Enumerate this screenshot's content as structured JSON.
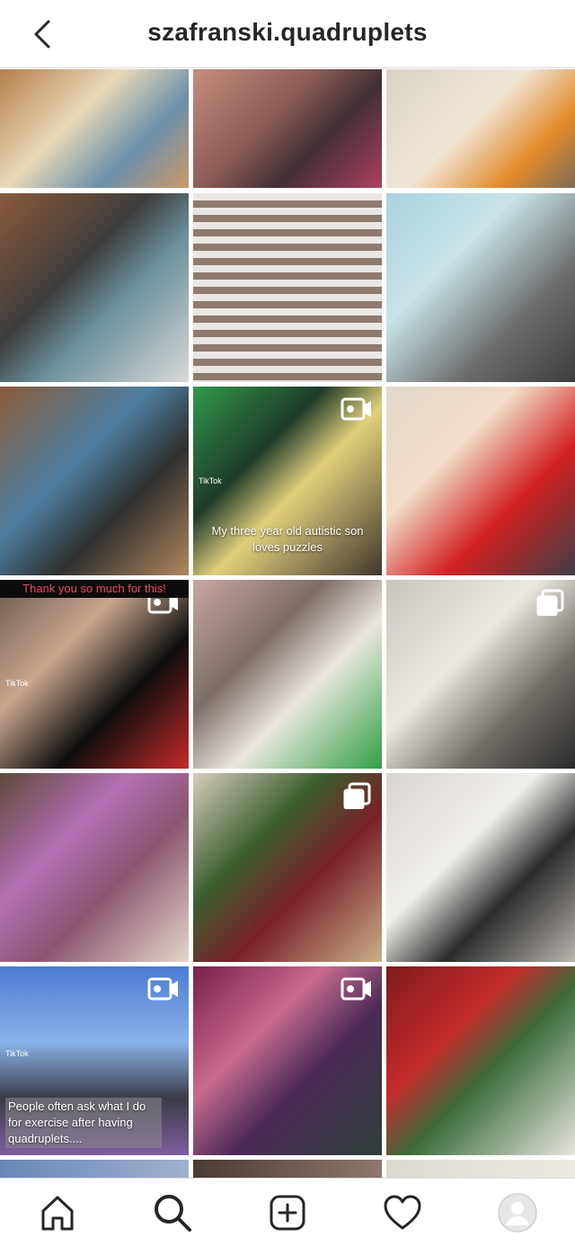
{
  "header": {
    "title": "szafranski.quadruplets"
  },
  "tiles": [
    {
      "bg": "linear-gradient(135deg,#b67f48 0%,#e8d9b8 40%,#6d8fa9 70%,#c99a6c 100%)"
    },
    {
      "bg": "linear-gradient(135deg,#c68c7d 0%,#8e5d57 40%,#3f2f35 65%,#b13f61 100%)"
    },
    {
      "bg": "linear-gradient(135deg,#d9d2c4 0%,#f0e6d8 45%,#e38a2a 75%,#7d6e5a 100%)"
    },
    {
      "bg": "linear-gradient(135deg,#8b5a3c 0%,#3d3d3d 40%,#6b8f9a 60%,#d9d9d9 100%)"
    },
    {
      "bg": "repeating-linear-gradient(180deg,#e9e6e3 0px,#e9e6e3 8px,#8f7a6e 8px,#8f7a6e 16px)"
    },
    {
      "bg": "linear-gradient(135deg,#a9d3dc 0%,#c9e3e8 35%,#6a6a6a 70%,#3e3e3e 100%)"
    },
    {
      "bg": "linear-gradient(135deg,#8a5b3a 0%,#4e7fa0 40%,#2f2f2f 65%,#b0885f 100%)",
      "caption": "",
      "tiktok": ""
    },
    {
      "bg": "linear-gradient(135deg,#2f9a4b 0%,#1f3a2a 35%,#e0d07a 55%,#40362f 100%)",
      "caption": "My three year old autistic son loves puzzles",
      "tiktok": "TikTok"
    },
    {
      "bg": "linear-gradient(135deg,#e2d9cc 0%,#f1dcc9 35%,#d3211f 65%,#3d3e48 100%)"
    },
    {
      "bg": "linear-gradient(135deg,#6b5a50 0%,#c8a68f 35%,#0d0d0d 65%,#c62a2b 100%)",
      "caption": "Thank you so much for this!",
      "tiktok": "TikTok"
    },
    {
      "bg": "linear-gradient(135deg,#c9a7a2 0%,#7d6d66 35%,#ebe6e0 60%,#2fa043 100%)"
    },
    {
      "bg": "linear-gradient(135deg,#c7c3bd 0%,#ece8e2 40%,#6f6a64 70%,#2a2a2a 100%)"
    },
    {
      "bg": "linear-gradient(135deg,#5c4a3a 0%,#b56fb3 35%,#8a5670 60%,#e4d7cb 100%)"
    },
    {
      "bg": "linear-gradient(135deg,#d7cdbd 0%,#3c5d2f 35%,#7a1f2a 60%,#c9b18a 100%)"
    },
    {
      "bg": "linear-gradient(135deg,#d8d5d0 0%,#f2f0ec 40%,#2c2c2c 65%,#b9b4ae 100%)"
    },
    {
      "bg": "linear-gradient(180deg,#4b7bd2 0%,#8ab2ea 40%,#3b3b46 70%,#7f5fa0 100%)",
      "caption": "People often ask what I do for exercise after having quadruplets....",
      "tiktok": "TikTok"
    },
    {
      "bg": "linear-gradient(135deg,#7a1e4a 0%,#c96a8e 35%,#4a2a55 60%,#2f3f3a 100%)"
    },
    {
      "bg": "linear-gradient(135deg,#7f1b1b 0%,#c42b2b 35%,#3b6b3b 55%,#e8e4df 100%)"
    },
    {
      "bg": "linear-gradient(90deg,#6a86b6 0%,#9fb1cf 100%)"
    },
    {
      "bg": "linear-gradient(90deg,#4a3a34 0%,#8f786e 100%)"
    },
    {
      "bg": "linear-gradient(90deg,#ddd8d1 0%,#efe9e3 100%)"
    }
  ],
  "badges": [
    "",
    "",
    "",
    "",
    "",
    "",
    "",
    "video",
    "",
    "video",
    "",
    "multi",
    "",
    "multi",
    "",
    "video",
    "video",
    "",
    "",
    "",
    ""
  ],
  "nav": {
    "items": [
      "home-icon",
      "search-icon",
      "create-icon",
      "activity-icon",
      "profile-icon"
    ]
  }
}
